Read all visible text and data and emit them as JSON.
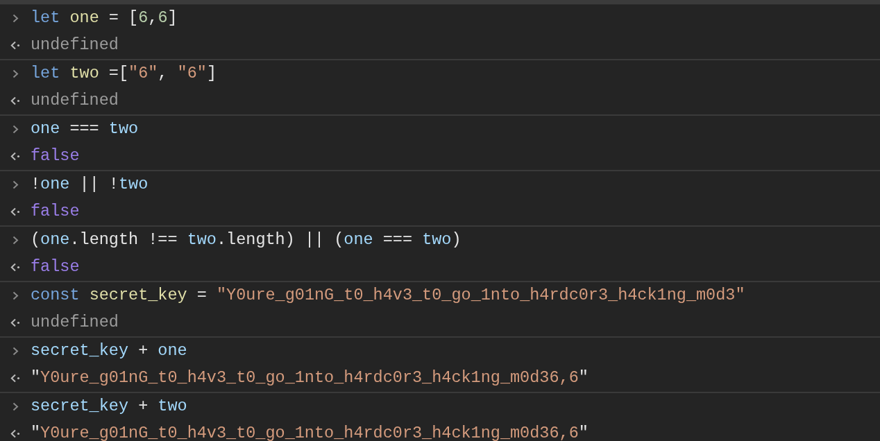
{
  "console": {
    "entries": [
      {
        "input": [
          {
            "text": "let ",
            "kind": "keyword"
          },
          {
            "text": "one",
            "kind": "declared"
          },
          {
            "text": " = [",
            "kind": "punct"
          },
          {
            "text": "6",
            "kind": "number"
          },
          {
            "text": ",",
            "kind": "punct"
          },
          {
            "text": "6",
            "kind": "number"
          },
          {
            "text": "]",
            "kind": "punct"
          }
        ],
        "output": [
          {
            "text": "undefined",
            "kind": "undefined"
          }
        ]
      },
      {
        "input": [
          {
            "text": "let ",
            "kind": "keyword"
          },
          {
            "text": "two",
            "kind": "declared"
          },
          {
            "text": " =[",
            "kind": "punct"
          },
          {
            "text": "\"6\"",
            "kind": "string"
          },
          {
            "text": ", ",
            "kind": "punct"
          },
          {
            "text": "\"6\"",
            "kind": "string"
          },
          {
            "text": "]",
            "kind": "punct"
          }
        ],
        "output": [
          {
            "text": "undefined",
            "kind": "undefined"
          }
        ]
      },
      {
        "input": [
          {
            "text": "one",
            "kind": "identifier"
          },
          {
            "text": " === ",
            "kind": "punct"
          },
          {
            "text": "two",
            "kind": "identifier"
          }
        ],
        "output": [
          {
            "text": "false",
            "kind": "boolean"
          }
        ]
      },
      {
        "input": [
          {
            "text": "!",
            "kind": "punct"
          },
          {
            "text": "one",
            "kind": "identifier"
          },
          {
            "text": " || !",
            "kind": "punct"
          },
          {
            "text": "two",
            "kind": "identifier"
          }
        ],
        "output": [
          {
            "text": "false",
            "kind": "boolean"
          }
        ]
      },
      {
        "input": [
          {
            "text": "(",
            "kind": "punct"
          },
          {
            "text": "one",
            "kind": "identifier"
          },
          {
            "text": ".length !== ",
            "kind": "punct"
          },
          {
            "text": "two",
            "kind": "identifier"
          },
          {
            "text": ".length) || (",
            "kind": "punct"
          },
          {
            "text": "one",
            "kind": "identifier"
          },
          {
            "text": " === ",
            "kind": "punct"
          },
          {
            "text": "two",
            "kind": "identifier"
          },
          {
            "text": ")",
            "kind": "punct"
          }
        ],
        "output": [
          {
            "text": "false",
            "kind": "boolean"
          }
        ]
      },
      {
        "input": [
          {
            "text": "const ",
            "kind": "keyword"
          },
          {
            "text": "secret_key",
            "kind": "declared"
          },
          {
            "text": " = ",
            "kind": "punct"
          },
          {
            "text": "\"Y0ure_g01nG_t0_h4v3_t0_go_1nto_h4rdc0r3_h4ck1ng_m0d3\"",
            "kind": "string"
          }
        ],
        "output": [
          {
            "text": "undefined",
            "kind": "undefined"
          }
        ]
      },
      {
        "input": [
          {
            "text": "secret_key",
            "kind": "identifier"
          },
          {
            "text": " + ",
            "kind": "punct"
          },
          {
            "text": "one",
            "kind": "identifier"
          }
        ],
        "output": [
          {
            "text": "\"",
            "kind": "punct"
          },
          {
            "text": "Y0ure_g01nG_t0_h4v3_t0_go_1nto_h4rdc0r3_h4ck1ng_m0d36,6",
            "kind": "string"
          },
          {
            "text": "\"",
            "kind": "punct"
          }
        ]
      },
      {
        "input": [
          {
            "text": "secret_key",
            "kind": "identifier"
          },
          {
            "text": " + ",
            "kind": "punct"
          },
          {
            "text": "two",
            "kind": "identifier"
          }
        ],
        "output": [
          {
            "text": "\"",
            "kind": "punct"
          },
          {
            "text": "Y0ure_g01nG_t0_h4v3_t0_go_1nto_h4rdc0r3_h4ck1ng_m0d36,6",
            "kind": "string"
          },
          {
            "text": "\"",
            "kind": "punct"
          }
        ]
      }
    ]
  }
}
